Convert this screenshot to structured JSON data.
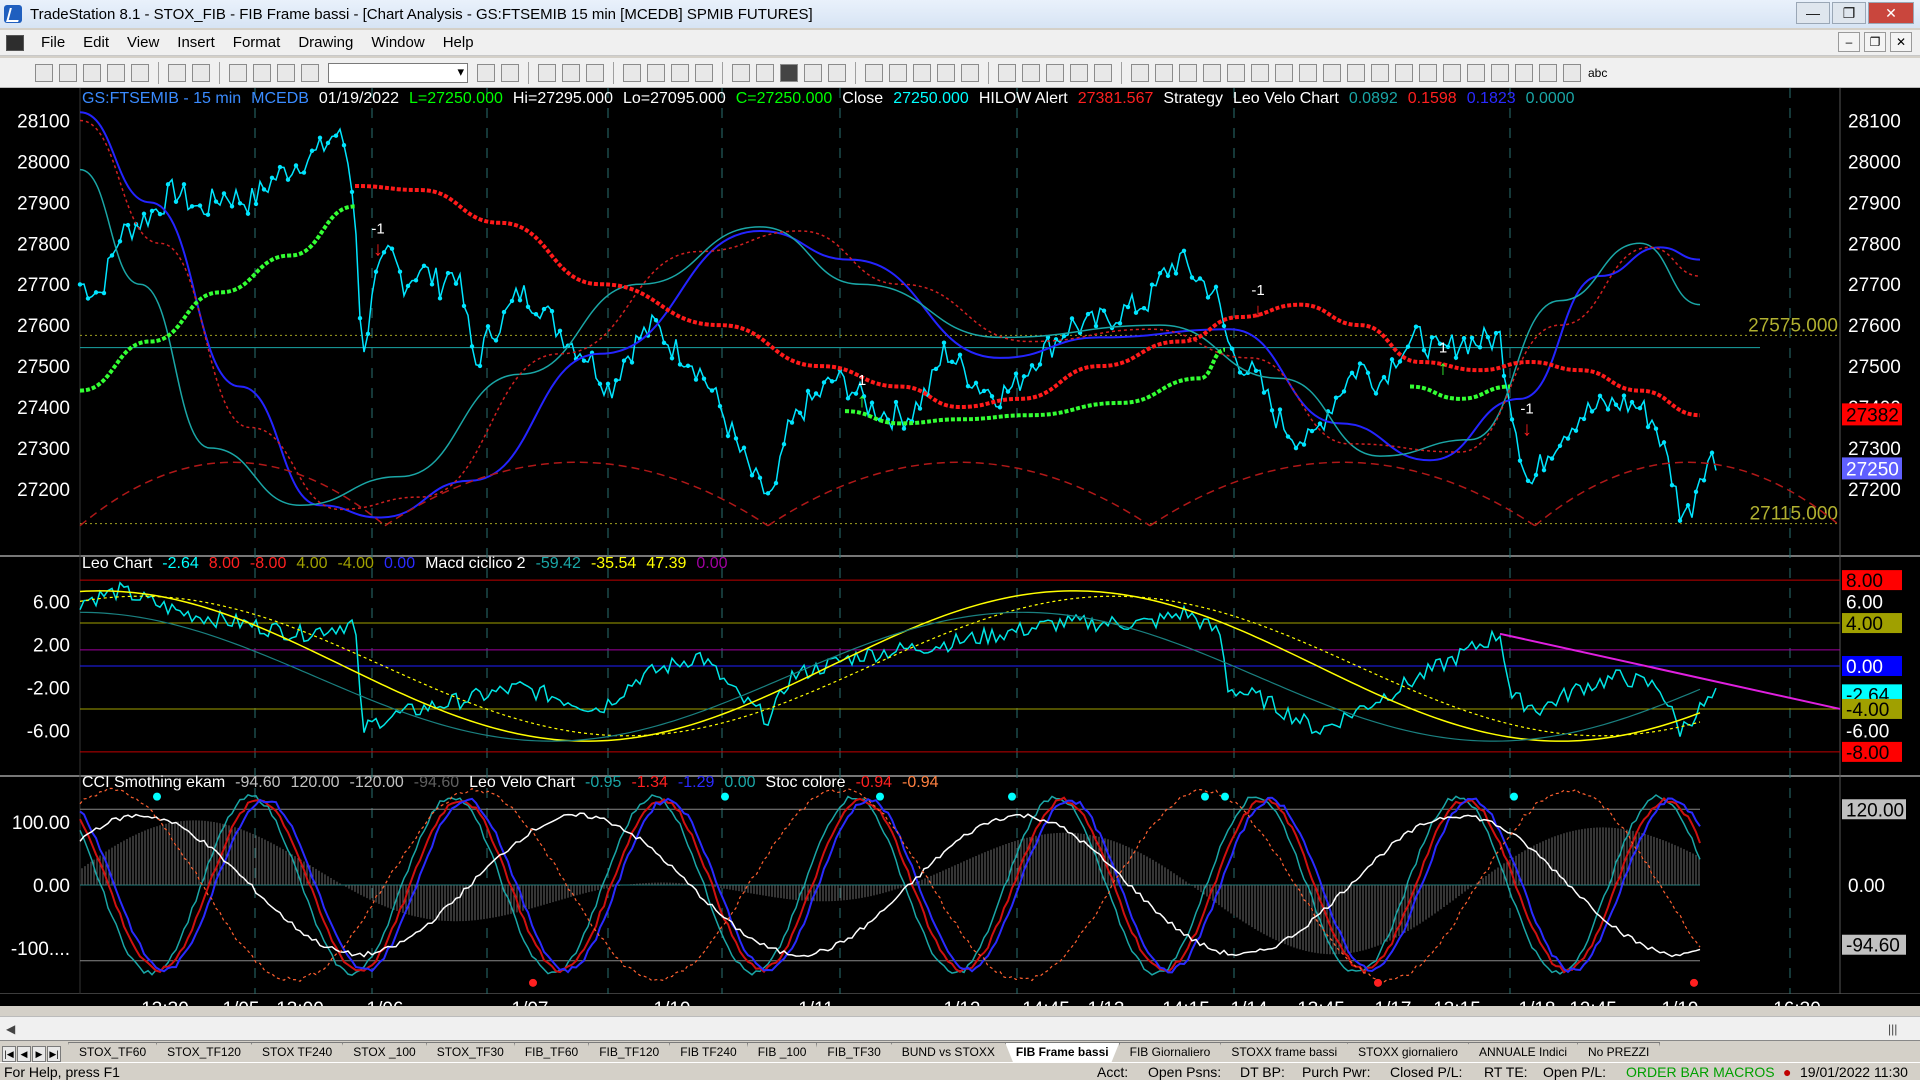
{
  "window": {
    "title": "TradeStation 8.1 - STOX_FIB - FIB Frame bassi - [Chart Analysis - GS:FTSEMIB  15 min  [MCEDB] SPMIB FUTURES]",
    "controls": [
      "—",
      "❐",
      "✕"
    ]
  },
  "menu": {
    "items": [
      "File",
      "Edit",
      "View",
      "Insert",
      "Format",
      "Drawing",
      "Window",
      "Help"
    ],
    "mdi_controls": [
      "–",
      "❐",
      "✕"
    ]
  },
  "toolbar": {
    "text_tool_label": "abc"
  },
  "price_pane": {
    "header": [
      {
        "text": "GS:FTSEMIB - 15 min",
        "color": "#3a8bff"
      },
      {
        "text": "MCEDB",
        "color": "#3a8bff"
      },
      {
        "text": "01/19/2022",
        "color": "#ffffff"
      },
      {
        "text": "L=27250.000",
        "color": "#00ff00"
      },
      {
        "text": "Hi=27295.000",
        "color": "#ffffff"
      },
      {
        "text": "Lo=27095.000",
        "color": "#ffffff"
      },
      {
        "text": "C=27250.000",
        "color": "#00ff00"
      },
      {
        "text": "Close",
        "color": "#ffffff"
      },
      {
        "text": "27250.000",
        "color": "#00ffff"
      },
      {
        "text": "HILOW Alert",
        "color": "#ffffff"
      },
      {
        "text": "27381.567",
        "color": "#ff2020"
      },
      {
        "text": "Strategy",
        "color": "#ffffff"
      },
      {
        "text": "Leo Velo Chart",
        "color": "#ffffff"
      },
      {
        "text": "0.0892",
        "color": "#1aa6a6"
      },
      {
        "text": "0.1598",
        "color": "#ff2020"
      },
      {
        "text": "0.1823",
        "color": "#2a2aff"
      },
      {
        "text": "0.0000",
        "color": "#1aa6a6"
      }
    ],
    "y_ticks": [
      "28100",
      "28000",
      "27900",
      "27800",
      "27700",
      "27600",
      "27500",
      "27400",
      "27300",
      "27200"
    ],
    "hilo_labels": [
      "27575.000",
      "27115.000"
    ],
    "axis_badges": [
      {
        "text": "27382",
        "bg": "#ff0000",
        "fg": "#000000"
      },
      {
        "text": "27250",
        "bg": "#6060ff",
        "fg": "#ffffff"
      }
    ],
    "signal_labels": [
      "-1",
      "1",
      "-1",
      "1",
      "-1"
    ]
  },
  "macd_pane": {
    "header": [
      {
        "text": "Leo Chart",
        "color": "#ffffff"
      },
      {
        "text": "-2.64",
        "color": "#00ffff"
      },
      {
        "text": "8.00",
        "color": "#ff2020"
      },
      {
        "text": "-8.00",
        "color": "#ff2020"
      },
      {
        "text": "4.00",
        "color": "#a0a000"
      },
      {
        "text": "-4.00",
        "color": "#a0a000"
      },
      {
        "text": "0.00",
        "color": "#2a2aff"
      },
      {
        "text": "Macd ciclico 2",
        "color": "#ffffff"
      },
      {
        "text": "-59.42",
        "color": "#1aa6a6"
      },
      {
        "text": "-35.54",
        "color": "#ffff00"
      },
      {
        "text": "47.39",
        "color": "#ffff00"
      },
      {
        "text": "0.00",
        "color": "#a000a0"
      }
    ],
    "y_ticks": [
      "6.00",
      "2.00",
      "-2.00",
      "-6.00"
    ],
    "axis_badges": [
      {
        "text": "8.00",
        "bg": "#ff0000",
        "fg": "#000000"
      },
      {
        "text": "6.00",
        "bg": "#000000",
        "fg": "#ffffff"
      },
      {
        "text": "4.00",
        "bg": "#a0a000",
        "fg": "#000000"
      },
      {
        "text": "0.00",
        "bg": "#0000ff",
        "fg": "#ffffff"
      },
      {
        "text": "-2.64",
        "bg": "#00ffff",
        "fg": "#000000"
      },
      {
        "text": "-4.00",
        "bg": "#a0a000",
        "fg": "#000000"
      },
      {
        "text": "-6.00",
        "bg": "#000000",
        "fg": "#ffffff"
      },
      {
        "text": "-8.00",
        "bg": "#ff0000",
        "fg": "#000000"
      }
    ]
  },
  "cci_pane": {
    "header": [
      {
        "text": "CCI Smothing ekam",
        "color": "#ffffff"
      },
      {
        "text": "-94.60",
        "color": "#c0c0c0"
      },
      {
        "text": "120.00",
        "color": "#c0c0c0"
      },
      {
        "text": "-120.00",
        "color": "#c0c0c0"
      },
      {
        "text": "-94.60",
        "color": "#606060"
      },
      {
        "text": "Leo Velo Chart",
        "color": "#ffffff"
      },
      {
        "text": "-0.95",
        "color": "#1aa6a6"
      },
      {
        "text": "-1.34",
        "color": "#ff2020"
      },
      {
        "text": "-1.29",
        "color": "#2a2aff"
      },
      {
        "text": "0.00",
        "color": "#1aa6a6"
      },
      {
        "text": "Stoc colore",
        "color": "#ffffff"
      },
      {
        "text": "-0.94",
        "color": "#ff2020"
      },
      {
        "text": "-0.94",
        "color": "#ff8040"
      }
    ],
    "y_ticks": [
      "100.00",
      "0.00",
      "-100...."
    ],
    "axis_badges": [
      {
        "text": "120.00",
        "bg": "#c0c0c0",
        "fg": "#000000"
      },
      {
        "text": "-94.60",
        "bg": "#c0c0c0",
        "fg": "#000000"
      }
    ]
  },
  "x_axis": {
    "labels": [
      "13:30",
      "1/05",
      "13:00",
      "1/06",
      "1/07",
      "1/10",
      "1/11",
      "1/12",
      "14:45",
      "1/13",
      "14:15",
      "1/14",
      "13:45",
      "1/17",
      "13:15",
      "1/18",
      "12:45",
      "1/19",
      "16:30"
    ]
  },
  "tabs": {
    "items": [
      "STOX_TF60",
      "STOX_TF120",
      "STOX TF240",
      "STOX _100",
      "STOX_TF30",
      "FIB_TF60",
      "FIB_TF120",
      "FIB TF240",
      "FIB _100",
      "FIB_TF30",
      "BUND vs STOXX",
      "FIB Frame bassi",
      "FIB Giornaliero",
      "STOXX frame bassi",
      "STOXX giornaliero",
      "ANNUALE Indici",
      "No PREZZI"
    ],
    "active_index": 11
  },
  "status": {
    "help": "For Help, press F1",
    "acct": "Acct:",
    "open_psns": "Open Psns:",
    "dt_bp": "DT BP:",
    "purch_pwr": "Purch Pwr:",
    "closed_pl": "Closed P/L:",
    "rt_te": "RT TE:",
    "open_pl": "Open P/L:",
    "order_bar": "ORDER BAR MACROS",
    "datetime": "19/01/2022 11:30"
  },
  "colors": {
    "price_line": "#00e5ff",
    "ma_red": "#ff1a1a",
    "ma_green": "#33ff33",
    "band_blue": "#2424ff",
    "band_teal": "#1aa6a6",
    "magenta": "#e020e0",
    "yellow": "#ffff00"
  }
}
